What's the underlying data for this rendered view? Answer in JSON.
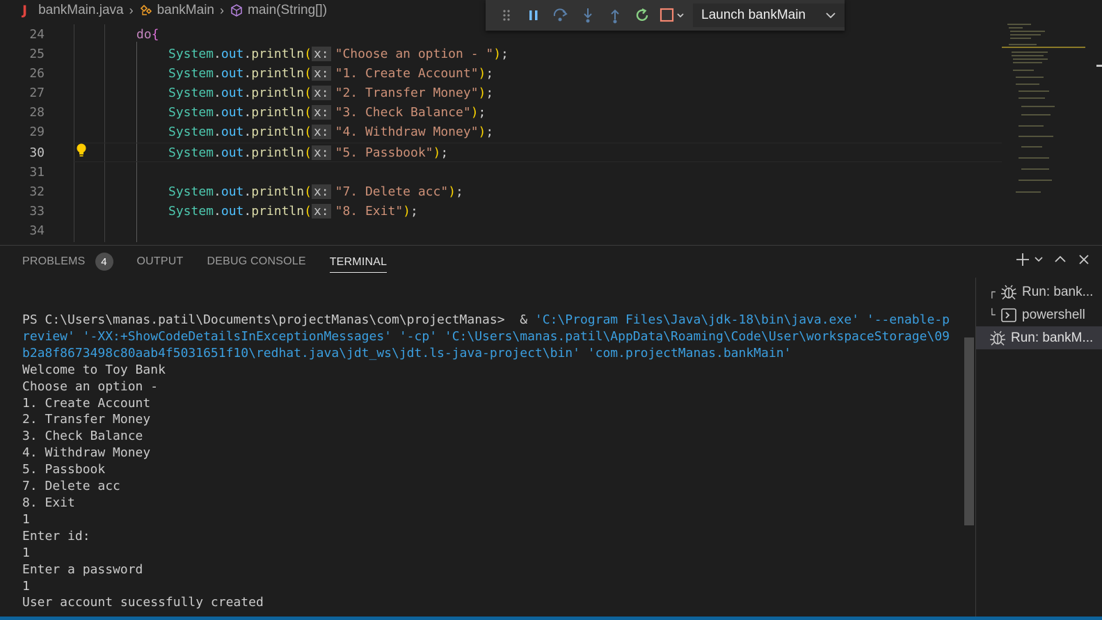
{
  "breadcrumb": {
    "file_icon": "java-icon",
    "file": "bankMain.java",
    "class": "bankMain",
    "method": "main(String[])"
  },
  "debug_toolbar": {
    "launch_config": "Launch bankMain",
    "buttons": [
      "drag-handle-icon",
      "pause-icon",
      "step-over-icon",
      "step-into-icon",
      "step-out-icon",
      "restart-icon",
      "stop-icon"
    ]
  },
  "editor": {
    "line_numbers": [
      "24",
      "25",
      "26",
      "27",
      "28",
      "29",
      "30",
      "31",
      "32",
      "33",
      "34"
    ],
    "active_line": "30",
    "do_keyword": "do",
    "do_brace": "{",
    "lines": [
      {
        "obj": "System",
        "field": "out",
        "method": "println",
        "hint": "x:",
        "arg": "\"Choose an option - \""
      },
      {
        "obj": "System",
        "field": "out",
        "method": "println",
        "hint": "x:",
        "arg": "\"1. Create Account\""
      },
      {
        "obj": "System",
        "field": "out",
        "method": "println",
        "hint": "x:",
        "arg": "\"2. Transfer Money\""
      },
      {
        "obj": "System",
        "field": "out",
        "method": "println",
        "hint": "x:",
        "arg": "\"3. Check Balance\""
      },
      {
        "obj": "System",
        "field": "out",
        "method": "println",
        "hint": "x:",
        "arg": "\"4. Withdraw Money\""
      },
      {
        "obj": "System",
        "field": "out",
        "method": "println",
        "hint": "x:",
        "arg": "\"5. Passbook\""
      },
      {
        "obj": "System",
        "field": "out",
        "method": "println",
        "hint": "x:",
        "arg": "\"7. Delete acc\""
      },
      {
        "obj": "System",
        "field": "out",
        "method": "println",
        "hint": "x:",
        "arg": "\"8. Exit\""
      }
    ]
  },
  "panel": {
    "tabs": [
      {
        "label": "PROBLEMS",
        "badge": "4"
      },
      {
        "label": "OUTPUT"
      },
      {
        "label": "DEBUG CONSOLE"
      },
      {
        "label": "TERMINAL"
      }
    ],
    "active_tab": "TERMINAL"
  },
  "terminal": {
    "prompt": "PS C:\\Users\\manas.patil\\Documents\\projectManas\\com\\projectManas>  & ",
    "command_1": "'C:\\Program Files\\Java\\jdk-18\\bin\\java.exe' '--enable-p",
    "command_2": "review' '-XX:+ShowCodeDetailsInExceptionMessages' '-cp' 'C:\\Users\\manas.patil\\AppData\\Roaming\\Code\\User\\workspaceStorage\\09",
    "command_3": "b2a8f8673498c80aab4f5031651f10\\redhat.java\\jdt_ws\\jdt.ls-java-project\\bin' 'com.projectManas.bankMain'",
    "output": [
      "Welcome to Toy Bank",
      "Choose an option -",
      "1. Create Account",
      "2. Transfer Money",
      "3. Check Balance",
      "4. Withdraw Money",
      "5. Passbook",
      "7. Delete acc",
      "8. Exit",
      "1",
      "Enter id:",
      "1",
      "Enter a password",
      "1",
      "User account sucessfully created"
    ]
  },
  "terminal_list": [
    {
      "tree": "┌",
      "icon": "debug-icon",
      "label": "Run: bank..."
    },
    {
      "tree": "└",
      "icon": "terminal-icon",
      "label": "powershell"
    },
    {
      "tree": "",
      "icon": "debug-icon",
      "label": "Run: bankM..."
    }
  ]
}
